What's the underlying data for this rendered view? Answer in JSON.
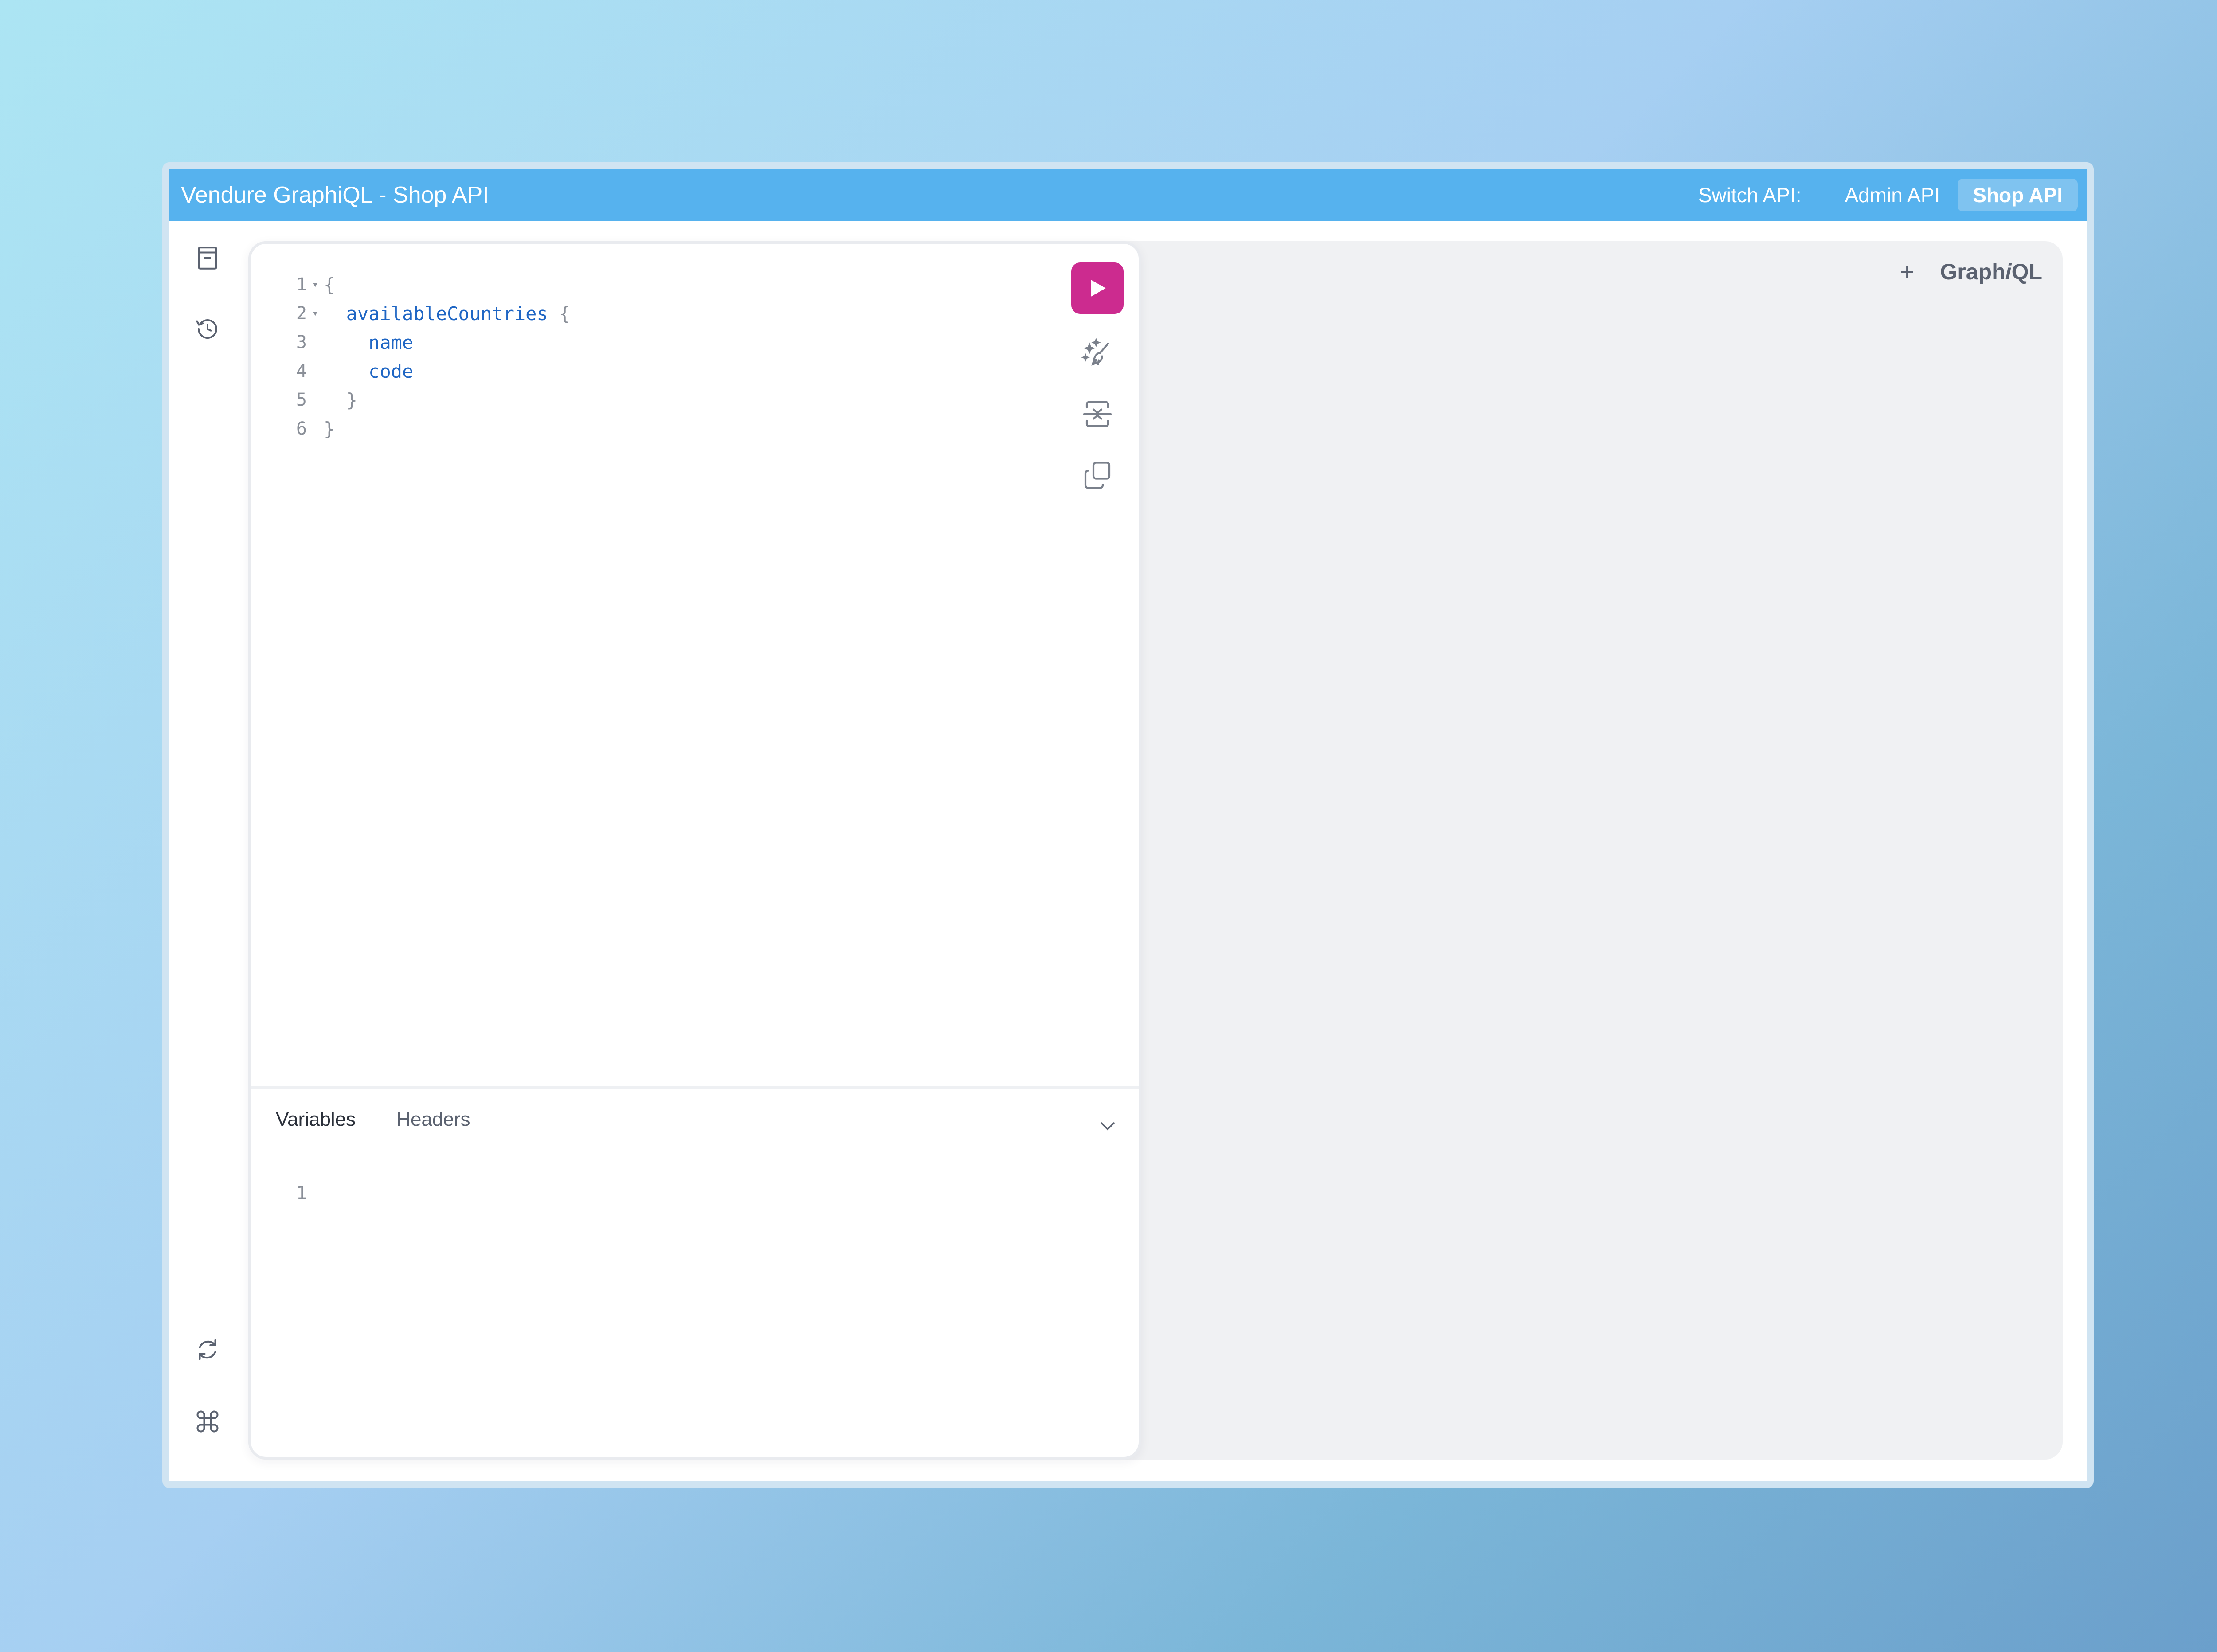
{
  "titlebar": {
    "title": "Vendure GraphiQL - Shop API",
    "switch_label": "Switch API:",
    "apis": [
      {
        "label": "Admin API",
        "active": false
      },
      {
        "label": "Shop API",
        "active": true
      }
    ]
  },
  "sidebar": {
    "top_icons": [
      "docs-icon",
      "history-icon"
    ],
    "bottom_icons": [
      "refetch-schema-icon",
      "keyboard-shortcuts-icon",
      "settings-icon"
    ]
  },
  "editor": {
    "lines": [
      {
        "n": "1",
        "fold": "▾",
        "indent": "",
        "token": "{",
        "kind": "punct"
      },
      {
        "n": "2",
        "fold": "▾",
        "indent": "  ",
        "token": "availableCountries",
        "suffix": " {",
        "kind": "field"
      },
      {
        "n": "3",
        "fold": "",
        "indent": "    ",
        "token": "name",
        "kind": "field"
      },
      {
        "n": "4",
        "fold": "",
        "indent": "    ",
        "token": "code",
        "kind": "field"
      },
      {
        "n": "5",
        "fold": "",
        "indent": "  ",
        "token": "}",
        "kind": "punct"
      },
      {
        "n": "6",
        "fold": "",
        "indent": "",
        "token": "}",
        "kind": "punct"
      }
    ],
    "toolbar": [
      "play-icon",
      "prettify-icon",
      "merge-fragments-icon",
      "copy-icon"
    ]
  },
  "bottom_panel": {
    "tabs": [
      {
        "label": "Variables",
        "active": true
      },
      {
        "label": "Headers",
        "active": false
      }
    ],
    "variables_line": "1"
  },
  "result": {
    "add_tab": "+",
    "brand_prefix": "Graph",
    "brand_italic": "i",
    "brand_suffix": "QL"
  },
  "colors": {
    "titlebar": "#56b2ee",
    "run_button": "#cc2b8f",
    "field": "#1f66c4"
  }
}
